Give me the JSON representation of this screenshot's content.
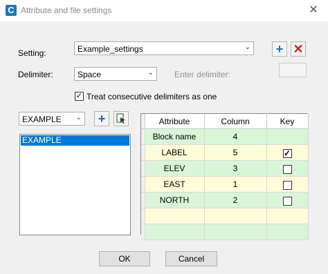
{
  "window": {
    "title": "Attribute and file settings",
    "app_icon": "C",
    "close_glyph": "✕"
  },
  "setting": {
    "label": "Setting:",
    "value": "Example_settings",
    "add_icon": "plus-icon",
    "delete_icon": "delete-icon"
  },
  "delimiter": {
    "label": "Delimiter:",
    "value": "Space",
    "enter_label": "Enter delimiter:",
    "enter_value": ""
  },
  "consecutive": {
    "label": "Treat consecutive delimiters as one",
    "checked": true
  },
  "block": {
    "value": "EXAMPLE",
    "items": [
      "EXAMPLE"
    ]
  },
  "table": {
    "headers": [
      "Attribute",
      "Column",
      "Key"
    ],
    "rows": [
      {
        "attribute": "Block name",
        "column": "4",
        "key": null
      },
      {
        "attribute": "LABEL",
        "column": "5",
        "key": true
      },
      {
        "attribute": "ELEV",
        "column": "3",
        "key": false
      },
      {
        "attribute": "EAST",
        "column": "1",
        "key": false
      },
      {
        "attribute": "NORTH",
        "column": "2",
        "key": false
      }
    ]
  },
  "buttons": {
    "ok": "OK",
    "cancel": "Cancel"
  },
  "colors": {
    "row_green": "#d8f5d8",
    "row_yellow": "#fffbd9",
    "selection": "#0078d7"
  }
}
